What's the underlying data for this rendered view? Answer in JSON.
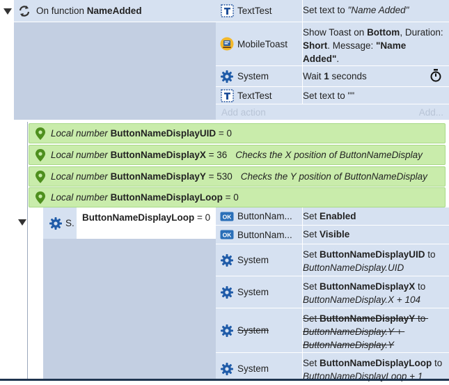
{
  "header": {
    "prefix": "On function ",
    "name": "NameAdded"
  },
  "event1_actions": [
    {
      "object": "TextTest",
      "icon": "text-object-icon",
      "parts": [
        {
          "t": "Set text to ",
          "s": ""
        },
        {
          "t": "\"Name Added\"",
          "s": "i"
        }
      ]
    },
    {
      "object": "MobileToast",
      "icon": "mobile-toast-icon",
      "parts": [
        {
          "t": "Show Toast on ",
          "s": ""
        },
        {
          "t": "Bottom",
          "s": "b"
        },
        {
          "t": ", Duration: ",
          "s": ""
        },
        {
          "t": "Short",
          "s": "b"
        },
        {
          "t": ". Message: ",
          "s": ""
        },
        {
          "t": "\"Name Added\"",
          "s": "b"
        },
        {
          "t": ".",
          "s": ""
        }
      ]
    },
    {
      "object": "System",
      "icon": "system-gear-icon",
      "parts": [
        {
          "t": "Wait ",
          "s": ""
        },
        {
          "t": "1",
          "s": "b"
        },
        {
          "t": " seconds",
          "s": ""
        }
      ]
    },
    {
      "object": "TextTest",
      "icon": "text-object-icon",
      "parts": [
        {
          "t": "Set text to \"\"",
          "s": ""
        }
      ]
    }
  ],
  "add_action": {
    "label": "Add action",
    "more": "Add..."
  },
  "locals": [
    {
      "kind": "Local number ",
      "name": "ButtonNameDisplayUID",
      "value": " = 0",
      "comment": ""
    },
    {
      "kind": "Local number ",
      "name": "ButtonNameDisplayX",
      "value": " = 36",
      "comment": "Checks the X position of ButtonNameDisplay"
    },
    {
      "kind": "Local number ",
      "name": "ButtonNameDisplayY",
      "value": " = 530",
      "comment": "Checks the Y position of ButtonNameDisplay"
    },
    {
      "kind": "Local number ",
      "name": "ButtonNameDisplayLoop",
      "value": " = 0",
      "comment": ""
    }
  ],
  "sub_event": {
    "system_short": "S.",
    "condition_name": "ButtonNameDisplayLoop",
    "condition_rest": " = 0"
  },
  "event2_actions": [
    {
      "object": "ButtonNam...",
      "icon": "button-object-icon",
      "strike": false,
      "parts": [
        {
          "t": "Set ",
          "s": ""
        },
        {
          "t": "Enabled",
          "s": "b"
        }
      ]
    },
    {
      "object": "ButtonNam...",
      "icon": "button-object-icon",
      "strike": false,
      "parts": [
        {
          "t": "Set ",
          "s": ""
        },
        {
          "t": "Visible",
          "s": "b"
        }
      ]
    },
    {
      "object": "System",
      "icon": "system-gear-icon",
      "strike": false,
      "parts": [
        {
          "t": "Set ",
          "s": ""
        },
        {
          "t": "ButtonNameDisplayUID",
          "s": "b"
        },
        {
          "t": " to ",
          "s": ""
        },
        {
          "t": "ButtonNameDisplay.UID",
          "s": "i"
        }
      ]
    },
    {
      "object": "System",
      "icon": "system-gear-icon",
      "strike": false,
      "parts": [
        {
          "t": "Set ",
          "s": ""
        },
        {
          "t": "ButtonNameDisplayX",
          "s": "b"
        },
        {
          "t": " to ",
          "s": ""
        },
        {
          "t": "ButtonNameDisplay.X + 104",
          "s": "i"
        }
      ]
    },
    {
      "object": "System",
      "icon": "system-gear-icon",
      "strike": true,
      "parts": [
        {
          "t": "Set ",
          "s": ""
        },
        {
          "t": "ButtonNameDisplayY",
          "s": "b"
        },
        {
          "t": " to ",
          "s": ""
        },
        {
          "t": "ButtonNameDisplay.Y + ButtonNameDisplay.Y",
          "s": "i"
        }
      ]
    },
    {
      "object": "System",
      "icon": "system-gear-icon",
      "strike": false,
      "parts": [
        {
          "t": "Set ",
          "s": ""
        },
        {
          "t": "ButtonNameDisplayLoop",
          "s": "b"
        },
        {
          "t": " to ",
          "s": ""
        },
        {
          "t": "ButtonNameDisplayLoop + 1",
          "s": "i"
        }
      ]
    }
  ]
}
